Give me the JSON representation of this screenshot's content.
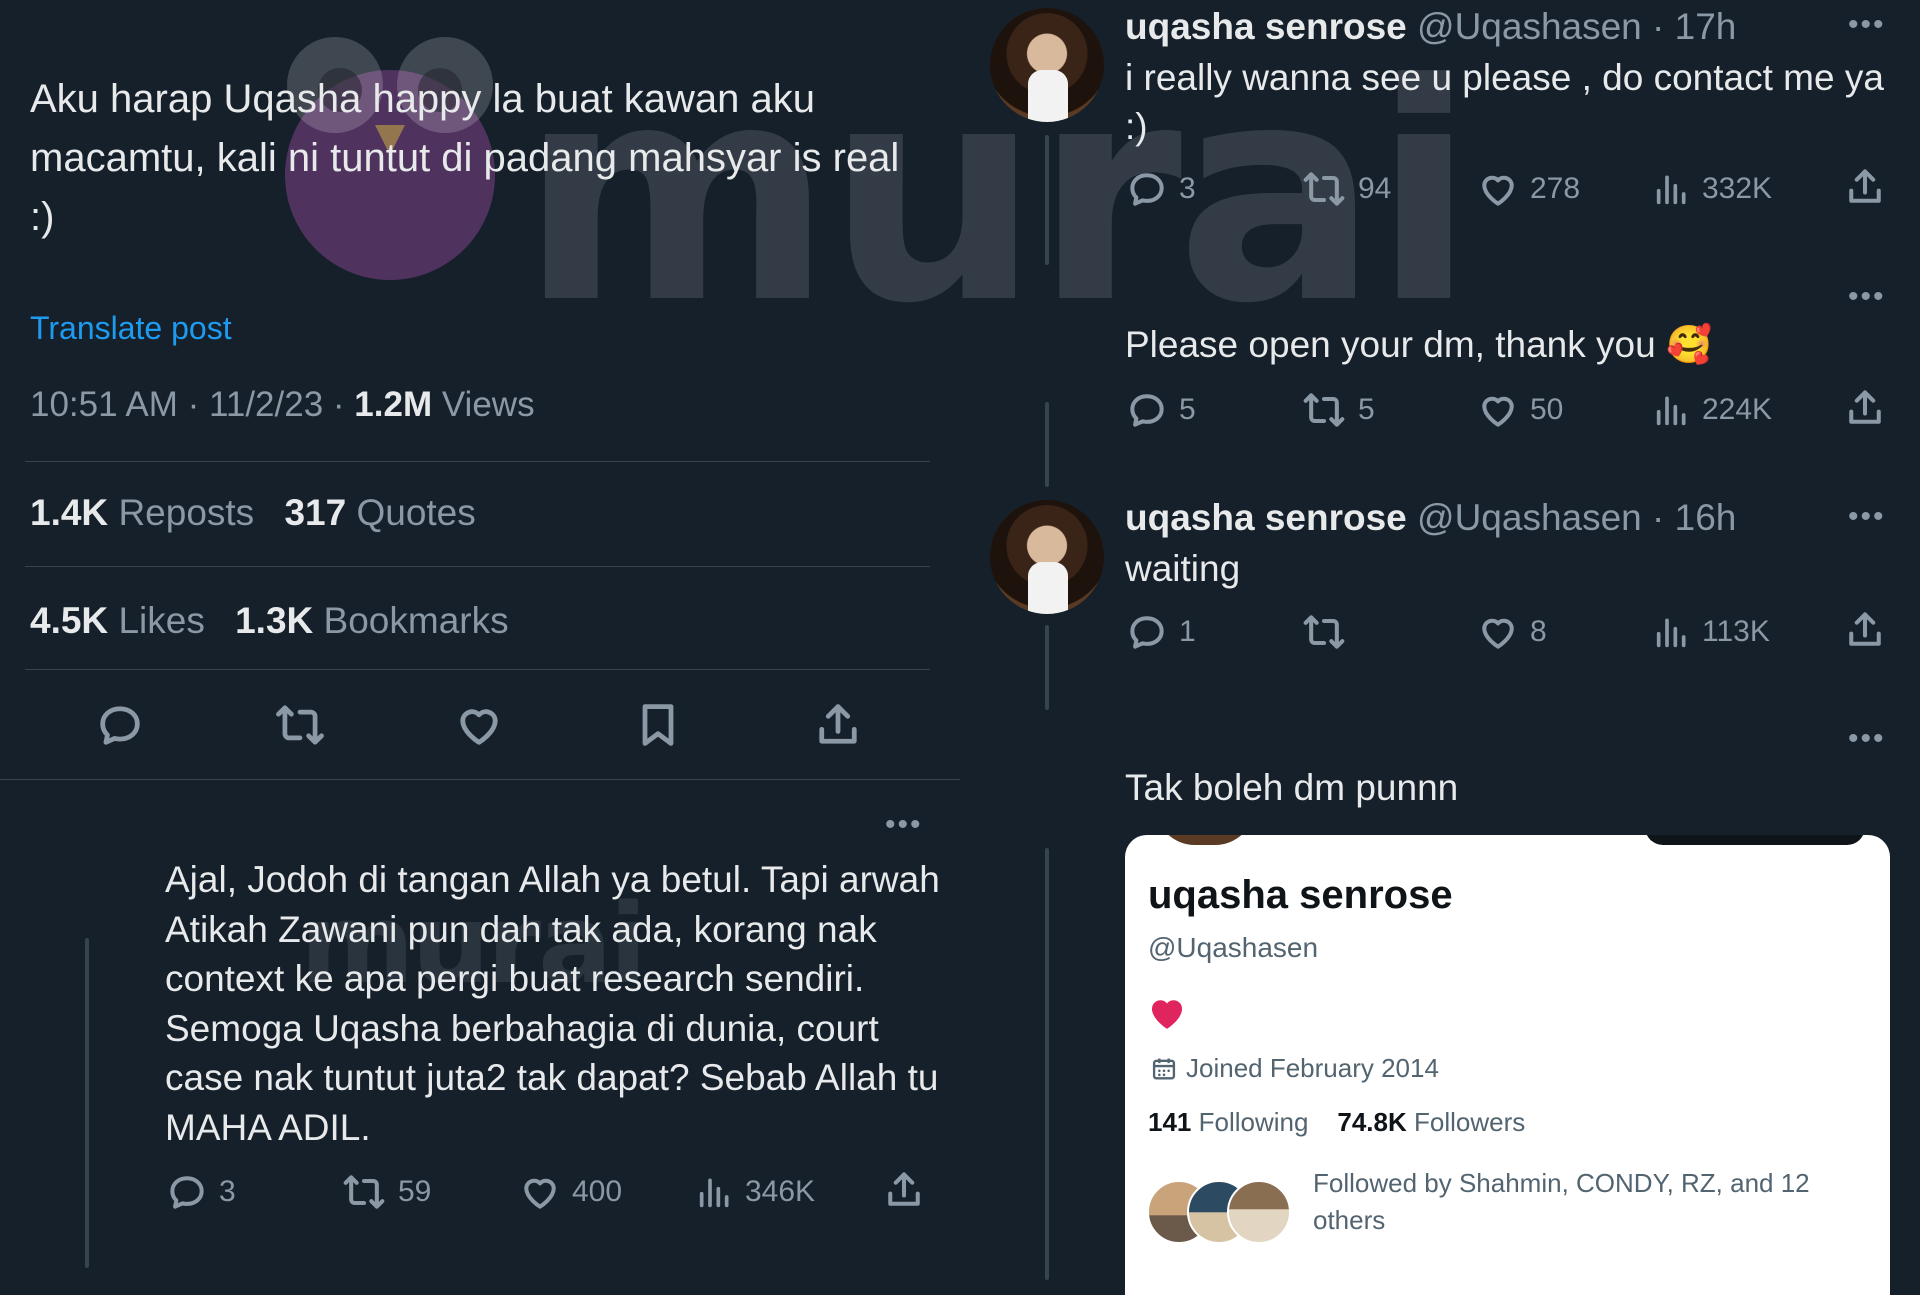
{
  "watermark": {
    "text": "murai"
  },
  "main_tweet": {
    "text": "Aku harap Uqasha happy la buat kawan aku macamtu, kali ni tuntut di padang mahsyar is real :)",
    "translate_label": "Translate post",
    "time": "10:51 AM",
    "date": "11/2/23",
    "views_count": "1.2M",
    "views_label": "Views",
    "reposts_count": "1.4K",
    "reposts_label": "Reposts",
    "quotes_count": "317",
    "quotes_label": "Quotes",
    "likes_count": "4.5K",
    "likes_label": "Likes",
    "bookmarks_count": "1.3K",
    "bookmarks_label": "Bookmarks"
  },
  "reply_tweet": {
    "text": "Ajal, Jodoh di tangan Allah ya betul. Tapi arwah Atikah Zawani pun dah tak ada, korang nak context ke apa pergi buat research sendiri. Semoga Uqasha berbahagia di dunia, court case nak tuntut juta2 tak dapat? Sebab Allah tu MAHA ADIL.",
    "replies": "3",
    "reposts": "59",
    "likes": "400",
    "views": "346K"
  },
  "thread": [
    {
      "name": "uqasha senrose",
      "handle": "@Uqashasen",
      "time": "17h",
      "text": "i really wanna see u please , do contact me ya :)",
      "replies": "3",
      "reposts": "94",
      "likes": "278",
      "views": "332K"
    },
    {
      "text": "Please open your dm, thank you 🥰",
      "replies": "5",
      "reposts": "5",
      "likes": "50",
      "views": "224K"
    },
    {
      "name": "uqasha senrose",
      "handle": "@Uqashasen",
      "time": "16h",
      "text": "waiting",
      "replies": "1",
      "reposts": "",
      "likes": "8",
      "views": "113K"
    },
    {
      "text": "Tak boleh dm punnn"
    }
  ],
  "profile_card": {
    "name": "uqasha senrose",
    "handle": "@Uqashasen",
    "bio": "❤️",
    "joined": "Joined February 2014",
    "following_count": "141",
    "following_label": "Following",
    "followers_count": "74.8K",
    "followers_label": "Followers",
    "followed_by": "Followed by Shahmin, CONDY, RZ, and 12 others"
  },
  "colors": {
    "background": "#15202b",
    "text": "#e7e9ea",
    "muted": "#8b98a5",
    "link": "#1d9bf0",
    "divider": "#38444d"
  }
}
